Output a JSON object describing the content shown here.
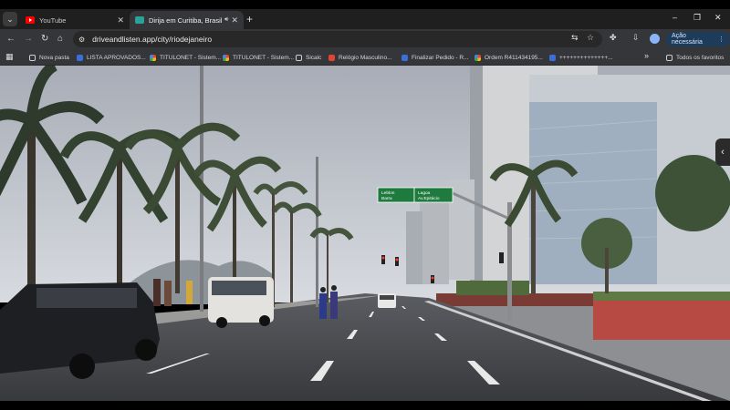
{
  "tabs": [
    {
      "title": "YouTube",
      "icon": "youtube-icon",
      "active": false
    },
    {
      "title": "Dirija em Curitiba, Brasil - D",
      "icon": "drive-and-listen-icon",
      "active": true
    }
  ],
  "toolbar": {
    "url": "driveandlisten.app/city/riodejaneiro",
    "action_button_label": "Ação necessária"
  },
  "bookmarks": [
    {
      "label": "Nova pasta",
      "icon": "folder-icon"
    },
    {
      "label": "LISTA APROVADOS...",
      "icon": "bookmark-icon"
    },
    {
      "label": "TITULONET - Sistem...",
      "icon": "google-icon"
    },
    {
      "label": "TITULONET - Sistem...",
      "icon": "google-icon"
    },
    {
      "label": "Sicalc",
      "icon": "globe-icon"
    },
    {
      "label": "Relógio Masculino...",
      "icon": "shop-icon"
    },
    {
      "label": "Finalizar Pedido - R...",
      "icon": "bookmark-icon"
    },
    {
      "label": "Ordem R411434195...",
      "icon": "google-icon"
    },
    {
      "label": "++++++++++++++...",
      "icon": "bookmark-icon"
    }
  ],
  "bookmarks_all_label": "Todos os favoritos",
  "road_sign": {
    "left_text": [
      "Leblon",
      "Barra"
    ],
    "right_text": [
      "Lagoa",
      "Av.Epitácio"
    ],
    "color": "#1f7a3d"
  }
}
